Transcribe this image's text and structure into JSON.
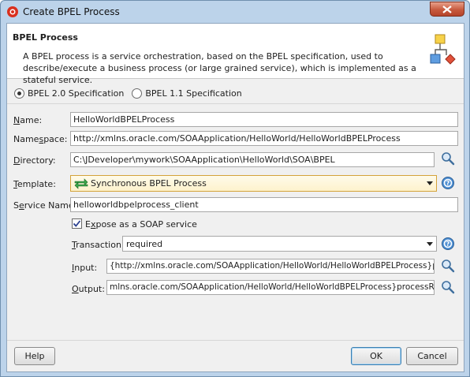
{
  "window": {
    "title": "Create BPEL Process"
  },
  "header": {
    "title": "BPEL Process",
    "description": "A BPEL process is a service orchestration, based on the BPEL specification, used to describe/execute a business process (or large grained service), which is implemented as a stateful service."
  },
  "spec": {
    "options": [
      "BPEL 2.0 Specification",
      "BPEL 1.1 Specification"
    ],
    "selected": "BPEL 2.0 Specification"
  },
  "form": {
    "name": {
      "label": "Name:",
      "value": "HelloWorldBPELProcess"
    },
    "namespace": {
      "label": "Namespace:",
      "value": "http://xmlns.oracle.com/SOAApplication/HelloWorld/HelloWorldBPELProcess"
    },
    "directory": {
      "label": "Directory:",
      "value": "C:\\JDeveloper\\mywork\\SOAApplication\\HelloWorld\\SOA\\BPEL"
    },
    "template": {
      "label": "Template:",
      "value": "Synchronous BPEL Process"
    },
    "service_name": {
      "label": "Service Name:",
      "value": "helloworldbpelprocess_client"
    },
    "expose_soap": {
      "label": "Expose as a SOAP service",
      "checked": true
    },
    "transaction": {
      "label": "Transaction:",
      "value": "required"
    },
    "input": {
      "label": "Input:",
      "value": "{http://xmlns.oracle.com/SOAApplication/HelloWorld/HelloWorldBPELProcess}process"
    },
    "output": {
      "label": "Output:",
      "value": "mlns.oracle.com/SOAApplication/HelloWorld/HelloWorldBPELProcess}processResponse"
    }
  },
  "buttons": {
    "help": "Help",
    "ok": "OK",
    "cancel": "Cancel"
  },
  "colors": {
    "accent": "#3c7fb1",
    "template_border": "#d4a33a",
    "close_red": "#c75a3e"
  }
}
